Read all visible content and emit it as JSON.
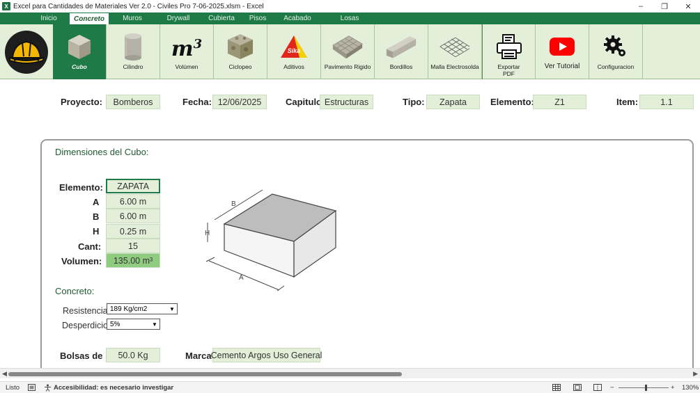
{
  "window": {
    "title": "Excel para Cantidades de Materiales Ver 2.0 - Civiles Pro 7-06-2025.xlsm - Excel",
    "app_icon": "X",
    "min": "–",
    "restore": "❐",
    "close": "✕"
  },
  "tabs": [
    "Inicio",
    "Concreto",
    "Muros",
    "Drywall",
    "Cubierta",
    "Pisos",
    "Acabado",
    "Losas"
  ],
  "ribbon": {
    "buttons": [
      {
        "label": "Cubo",
        "icon": "cube-icon"
      },
      {
        "label": "Cilindro",
        "icon": "cylinder-icon"
      },
      {
        "label": "Volúmen",
        "icon": "m3-icon"
      },
      {
        "label": "Ciclopeo",
        "icon": "stone-icon"
      },
      {
        "label": "Aditivos",
        "icon": "sika-icon"
      },
      {
        "label": "Pavimento Rigido",
        "icon": "pavement-icon"
      },
      {
        "label": "Bordillos",
        "icon": "curb-icon"
      },
      {
        "label": "Malla Electrosolda",
        "icon": "mesh-icon"
      },
      {
        "label": "Exportar PDF",
        "icon": "printer-icon"
      },
      {
        "label": "Ver Tutorial",
        "icon": "youtube-icon"
      },
      {
        "label": "Configuracion",
        "icon": "gear-icon"
      }
    ],
    "m3_text": "m",
    "m3_sup": "3",
    "sika_text": "Sika"
  },
  "header": {
    "proyecto_label": "Proyecto:",
    "proyecto": "Bomberos",
    "fecha_label": "Fecha:",
    "fecha": "12/06/2025",
    "capitulo_label": "Capitulo",
    "capitulo": "Estructuras",
    "tipo_label": "Tipo:",
    "tipo": "Zapata",
    "elemento_label": "Elemento:",
    "elemento": "Z1",
    "item_label": "Item:",
    "item": "1.1"
  },
  "cubo": {
    "title": "Dimensiones del Cubo:",
    "elemento_label": "Elemento:",
    "elemento": "ZAPATA",
    "a_label": "A",
    "a": "6.00 m",
    "b_label": "B",
    "b": "6.00 m",
    "h_label": "H",
    "h": "0.25 m",
    "cant_label": "Cant:",
    "cant": "15",
    "volumen_label": "Volumen:",
    "volumen": "135.00 m³",
    "diagram_labels": {
      "a": "A",
      "b": "B",
      "h": "H"
    }
  },
  "concreto": {
    "title": "Concreto:",
    "resistencia_label": "Resistencia",
    "resistencia": "189 Kg/cm2",
    "desperdicio_label": "Desperdicio",
    "desperdicio": "5%",
    "bolsas_label": "Bolsas de",
    "bolsas": "50.0 Kg",
    "marca_label": "Marca:",
    "marca": "Cemento Argos Uso General"
  },
  "status": {
    "ready": "Listo",
    "accessibility": "Accesibilidad: es necesario investigar",
    "zoom": "130%",
    "minus": "−",
    "plus": "+"
  },
  "colors": {
    "tab_bar": "#1e7a46",
    "ribbon_bg": "#e3efd9",
    "cell_bg": "#e3efd9",
    "volume_cell": "#8fcc7f",
    "section_title": "#1e5a30"
  }
}
